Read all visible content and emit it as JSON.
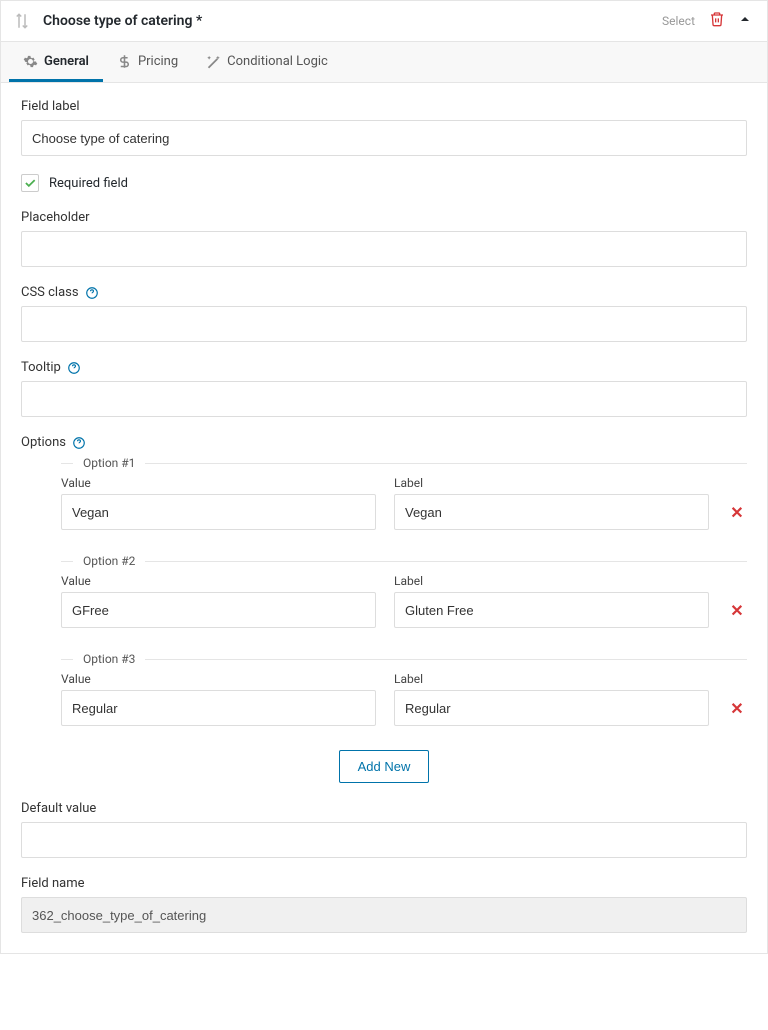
{
  "header": {
    "title": "Choose type of catering *",
    "select_label": "Select"
  },
  "tabs": {
    "general": "General",
    "pricing": "Pricing",
    "conditional": "Conditional Logic"
  },
  "fields": {
    "field_label_label": "Field label",
    "field_label_value": "Choose type of catering",
    "required_label": "Required field",
    "placeholder_label": "Placeholder",
    "placeholder_value": "",
    "css_class_label": "CSS class",
    "css_class_value": "",
    "tooltip_label": "Tooltip",
    "tooltip_value": "",
    "options_label": "Options",
    "default_value_label": "Default value",
    "default_value_value": "",
    "field_name_label": "Field name",
    "field_name_value": "362_choose_type_of_catering"
  },
  "option_labels": {
    "value": "Value",
    "label": "Label"
  },
  "options": [
    {
      "legend": "Option #1",
      "value": "Vegan",
      "label": "Vegan"
    },
    {
      "legend": "Option #2",
      "value": "GFree",
      "label": "Gluten Free"
    },
    {
      "legend": "Option #3",
      "value": "Regular",
      "label": "Regular"
    }
  ],
  "add_new_label": "Add New"
}
